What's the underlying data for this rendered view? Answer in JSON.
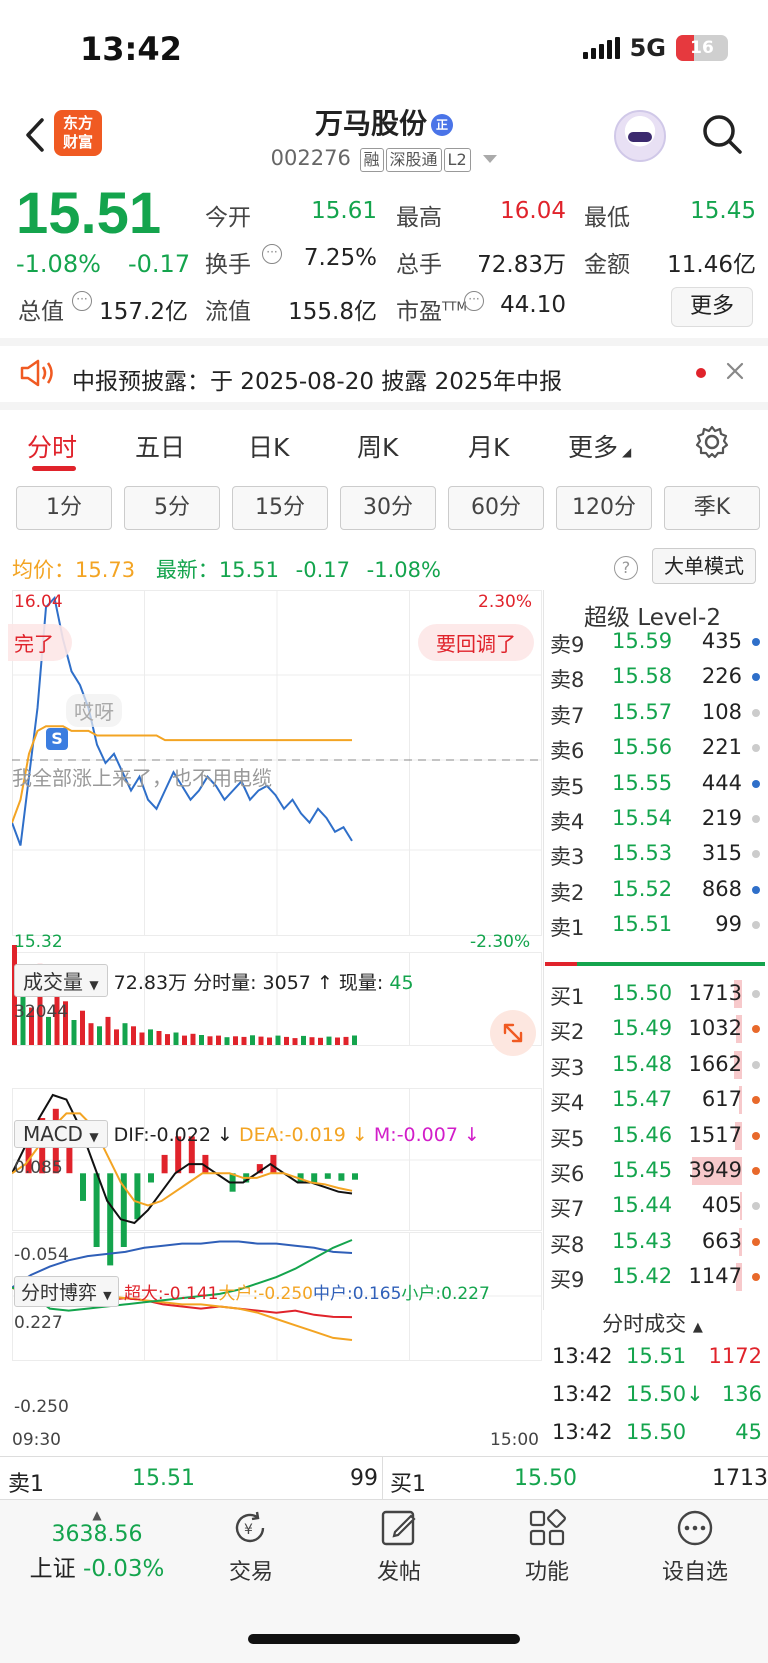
{
  "status_bar": {
    "time": "13:42",
    "network": "5G",
    "battery": "16"
  },
  "header": {
    "logo_line1": "东方",
    "logo_line2": "财富",
    "stock_name": "万马股份",
    "name_badge": "正",
    "code": "002276",
    "tags": [
      "融",
      "深股通",
      "L2"
    ]
  },
  "quote": {
    "price": "15.51",
    "change_pct": "-1.08%",
    "change_abs": "-0.17",
    "open_label": "今开",
    "open": "15.61",
    "high_label": "最高",
    "high": "16.04",
    "low_label": "最低",
    "low": "15.45",
    "turnover_label": "换手",
    "turnover": "7.25%",
    "volume_label": "总手",
    "volume": "72.83万",
    "amount_label": "金额",
    "amount": "11.46亿",
    "mktcap_label": "总值",
    "mktcap": "157.2亿",
    "float_label": "流值",
    "float": "155.8亿",
    "pe_label": "市盈",
    "pe_sup": "TTM",
    "pe": "44.10",
    "more_label": "更多"
  },
  "notice": {
    "text": "中报预披露：于 2025-08-20 披露 2025年中报"
  },
  "tabs": [
    "分时",
    "五日",
    "日K",
    "周K",
    "月K",
    "更多"
  ],
  "periods": [
    "1分",
    "5分",
    "15分",
    "30分",
    "60分",
    "120分",
    "季K"
  ],
  "info_row": {
    "avg_label": "均价：",
    "avg": "15.73",
    "latest_label": "最新：",
    "latest": "15.51",
    "chg": "-0.17",
    "pct": "-1.08%",
    "big_order_btn": "大单模式"
  },
  "chart_overlay": {
    "price_high": "16.04",
    "price_low": "15.32",
    "pct_high": "2.30%",
    "pct_low": "-2.30%",
    "bubble_left": "完了",
    "bubble_right": "要回调了",
    "comment_1": "哎呀",
    "comment_2": "我全部涨上来了，也不用电缆",
    "marker": "S"
  },
  "chart_data": [
    {
      "type": "line",
      "title": "分时",
      "x_range": [
        "09:30",
        "15:00"
      ],
      "ylim": [
        15.32,
        16.04
      ],
      "series": [
        {
          "name": "最新",
          "color": "#2f6fc9",
          "values": [
            15.55,
            15.5,
            15.65,
            15.8,
            16.02,
            16.04,
            15.95,
            15.88,
            15.85,
            15.8,
            15.72,
            15.68,
            15.7,
            15.66,
            15.62,
            15.65,
            15.6,
            15.58,
            15.62,
            15.66,
            15.63,
            15.6,
            15.62,
            15.65,
            15.63,
            15.6,
            15.62,
            15.64,
            15.6,
            15.62,
            15.63,
            15.61,
            15.58,
            15.6,
            15.57,
            15.55,
            15.58,
            15.56,
            15.53,
            15.54,
            15.51
          ]
        },
        {
          "name": "均价",
          "color": "#f3a423",
          "values": [
            15.55,
            15.6,
            15.7,
            15.75,
            15.76,
            15.76,
            15.76,
            15.75,
            15.75,
            15.75,
            15.74,
            15.74,
            15.74,
            15.74,
            15.74,
            15.74,
            15.74,
            15.74,
            15.73,
            15.73,
            15.73,
            15.73,
            15.73,
            15.73,
            15.73,
            15.73,
            15.73,
            15.73,
            15.73,
            15.73,
            15.73,
            15.73,
            15.73,
            15.73,
            15.73,
            15.73,
            15.73,
            15.73,
            15.73,
            15.73,
            15.73
          ]
        }
      ]
    },
    {
      "type": "bar",
      "title": "成交量",
      "ymax": 32044,
      "values": [
        32044,
        18000,
        12000,
        26000,
        9000,
        20000,
        14000,
        8000,
        11000,
        7000,
        6000,
        9000,
        5000,
        7000,
        6000,
        4000,
        5000,
        4500,
        3500,
        4000,
        3000,
        3600,
        3200,
        2800,
        3000,
        2500,
        2800,
        2600,
        3100,
        2700,
        2400,
        3000,
        2600,
        2200,
        2900,
        2500,
        2300,
        2700,
        2400,
        2600,
        3057
      ]
    },
    {
      "type": "bar",
      "title": "MACD",
      "ylim": [
        -0.054,
        0.085
      ],
      "series": [
        {
          "name": "DIF",
          "values": [
            0.0,
            0.03,
            0.06,
            0.085,
            0.08,
            0.05,
            0.01,
            -0.03,
            -0.05,
            -0.054,
            -0.04,
            -0.02,
            0.0,
            0.01,
            0.01,
            0.0,
            -0.01,
            -0.01,
            0.0,
            0.01,
            0.0,
            -0.01,
            -0.01,
            -0.015,
            -0.02,
            -0.022
          ]
        },
        {
          "name": "DEA",
          "values": [
            0.0,
            0.01,
            0.03,
            0.05,
            0.065,
            0.065,
            0.05,
            0.02,
            -0.01,
            -0.03,
            -0.035,
            -0.03,
            -0.02,
            -0.01,
            0.0,
            0.0,
            0.0,
            -0.005,
            -0.005,
            0.0,
            0.0,
            -0.005,
            -0.01,
            -0.012,
            -0.016,
            -0.019
          ]
        },
        {
          "name": "M",
          "values": [
            0.0,
            0.04,
            0.06,
            0.07,
            0.03,
            -0.03,
            -0.08,
            -0.1,
            -0.08,
            -0.05,
            -0.01,
            0.02,
            0.04,
            0.04,
            0.02,
            0.0,
            -0.02,
            -0.01,
            0.01,
            0.02,
            0.0,
            -0.01,
            -0.01,
            -0.006,
            -0.008,
            -0.007
          ]
        }
      ]
    },
    {
      "type": "line",
      "title": "分时博弈",
      "ylim": [
        -0.25,
        0.227
      ],
      "series": [
        {
          "name": "超大",
          "values": [
            0.0,
            0.02,
            -0.02,
            -0.05,
            -0.07,
            -0.06,
            -0.05,
            -0.06,
            -0.08,
            -0.09,
            -0.1,
            -0.09,
            -0.1,
            -0.11,
            -0.12,
            -0.11,
            -0.13,
            -0.14,
            -0.141
          ]
        },
        {
          "name": "大户",
          "values": [
            0.0,
            -0.05,
            0.05,
            0.02,
            -0.03,
            -0.04,
            -0.05,
            -0.06,
            -0.07,
            -0.08,
            -0.08,
            -0.09,
            -0.1,
            -0.12,
            -0.15,
            -0.18,
            -0.21,
            -0.24,
            -0.25
          ]
        },
        {
          "name": "中户",
          "values": [
            0.0,
            0.06,
            0.1,
            0.13,
            0.15,
            0.16,
            0.17,
            0.19,
            0.2,
            0.21,
            0.21,
            0.22,
            0.22,
            0.21,
            0.21,
            0.2,
            0.19,
            0.17,
            0.165
          ]
        },
        {
          "name": "小户",
          "values": [
            0.0,
            -0.03,
            -0.1,
            -0.11,
            -0.1,
            -0.09,
            -0.08,
            -0.07,
            -0.06,
            -0.05,
            -0.04,
            -0.03,
            -0.01,
            0.02,
            0.05,
            0.09,
            0.14,
            0.19,
            0.227
          ]
        }
      ]
    }
  ],
  "volume_header": {
    "label": "成交量",
    "total": "72.83万",
    "minute_label": "分时量:",
    "minute": "3057",
    "now_label": "现量:",
    "now": "45",
    "ymax": "32044"
  },
  "macd_header": {
    "label": "MACD",
    "dif": "DIF:-0.022",
    "dea": "DEA:-0.019",
    "m": "M:-0.007",
    "ymax": "0.085",
    "ymin": "-0.054"
  },
  "game_header": {
    "label": "分时博弈",
    "super": "超大:-0.141",
    "big": "大户:-0.250",
    "mid": "中户:0.165",
    "small": "小户:0.227",
    "ymax": "0.227",
    "ymin": "-0.250",
    "t_start": "09:30",
    "t_end": "15:00"
  },
  "order_book": {
    "title": "超级 Level-2",
    "asks": [
      {
        "label": "卖9",
        "price": "15.59",
        "vol": "435",
        "dot": "#2f6fc9"
      },
      {
        "label": "卖8",
        "price": "15.58",
        "vol": "226",
        "dot": "#2f6fc9"
      },
      {
        "label": "卖7",
        "price": "15.57",
        "vol": "108",
        "dot": "#cccccc"
      },
      {
        "label": "卖6",
        "price": "15.56",
        "vol": "221",
        "dot": "#cccccc"
      },
      {
        "label": "卖5",
        "price": "15.55",
        "vol": "444",
        "dot": "#2f6fc9"
      },
      {
        "label": "卖4",
        "price": "15.54",
        "vol": "219",
        "dot": "#cccccc"
      },
      {
        "label": "卖3",
        "price": "15.53",
        "vol": "315",
        "dot": "#cccccc"
      },
      {
        "label": "卖2",
        "price": "15.52",
        "vol": "868",
        "dot": "#2f6fc9"
      },
      {
        "label": "卖1",
        "price": "15.51",
        "vol": "99",
        "dot": "#cccccc"
      }
    ],
    "bids": [
      {
        "label": "买1",
        "price": "15.50",
        "vol": "1713",
        "dot": "#cccccc",
        "bar": 0.15
      },
      {
        "label": "买2",
        "price": "15.49",
        "vol": "1032",
        "dot": "#e8692b",
        "bar": 0.1
      },
      {
        "label": "买3",
        "price": "15.48",
        "vol": "1662",
        "dot": "#cccccc",
        "bar": 0.14
      },
      {
        "label": "买4",
        "price": "15.47",
        "vol": "617",
        "dot": "#e8692b",
        "bar": 0.05
      },
      {
        "label": "买5",
        "price": "15.46",
        "vol": "1517",
        "dot": "#e8692b",
        "bar": 0.13
      },
      {
        "label": "买6",
        "price": "15.45",
        "vol": "3949",
        "dot": "#e8692b",
        "bar": 0.9
      },
      {
        "label": "买7",
        "price": "15.44",
        "vol": "405",
        "dot": "#cccccc",
        "bar": 0.04
      },
      {
        "label": "买8",
        "price": "15.43",
        "vol": "663",
        "dot": "#e8692b",
        "bar": 0.06
      },
      {
        "label": "买9",
        "price": "15.42",
        "vol": "1147",
        "dot": "#e8692b",
        "bar": 0.1
      }
    ]
  },
  "ticks": {
    "title": "分时成交",
    "rows": [
      {
        "time": "13:42",
        "price": "15.51",
        "vol": "1172",
        "vol_color": "#e0232b"
      },
      {
        "time": "13:42",
        "price": "15.50↓",
        "vol": "136",
        "vol_color": "#14a44d"
      },
      {
        "time": "13:42",
        "price": "15.50",
        "vol": "45",
        "vol_color": "#14a44d"
      }
    ]
  },
  "strip": {
    "sell_label": "卖1",
    "sell_price": "15.51",
    "sell_vol": "99",
    "buy_label": "买1",
    "buy_price": "15.50",
    "buy_vol": "1713"
  },
  "bottom_nav": {
    "index_value": "3638.56",
    "index_name": "上证",
    "index_pct": "-0.03%",
    "items": [
      "交易",
      "发帖",
      "功能",
      "设自选"
    ]
  }
}
